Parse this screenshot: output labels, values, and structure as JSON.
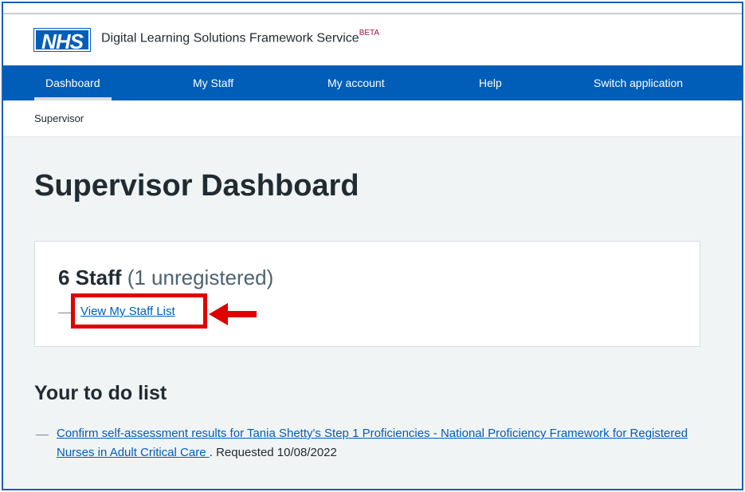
{
  "header": {
    "logo_text": "NHS",
    "service_name": "Digital Learning Solutions Framework Service",
    "beta_tag": "BETA"
  },
  "nav": {
    "items": [
      {
        "label": "Dashboard",
        "active": true
      },
      {
        "label": "My Staff",
        "active": false
      },
      {
        "label": "My account",
        "active": false
      },
      {
        "label": "Help",
        "active": false
      },
      {
        "label": "Switch application",
        "active": false
      }
    ]
  },
  "breadcrumb": {
    "label": "Supervisor"
  },
  "page": {
    "title": "Supervisor Dashboard"
  },
  "staff_card": {
    "count": "6 Staff",
    "unregistered": "(1 unregistered)",
    "link_label": "View My Staff List"
  },
  "todo": {
    "title": "Your to do list",
    "items": [
      {
        "link": "Confirm self-assessment results for Tania Shetty's Step 1 Proficiencies - National Proficiency Framework for Registered Nurses in Adult Critical Care ",
        "requested": ". Requested 10/08/2022"
      }
    ]
  },
  "annotation": {
    "highlight_color": "#e00000"
  },
  "colors": {
    "nhs_blue": "#005eb8",
    "background": "#f0f4f5",
    "text": "#212b32"
  }
}
